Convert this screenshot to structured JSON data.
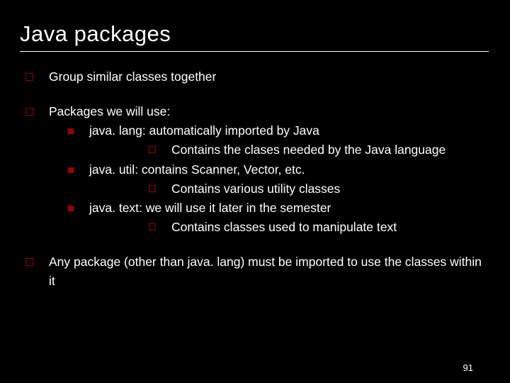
{
  "title": "Java packages",
  "bullets": {
    "b1": "Group similar classes together",
    "b2": "Packages we will use:",
    "b2a": "java. lang: automatically imported by Java",
    "b2a1": "Contains the clases needed by the Java language",
    "b2b": "java. util: contains Scanner, Vector, etc.",
    "b2b1": "Contains various utility classes",
    "b2c": "java. text: we will use it later in the semester",
    "b2c1": "Contains classes used to manipulate text",
    "b3": "Any package (other than java. lang) must be imported to use the classes within it"
  },
  "page_number": "91"
}
